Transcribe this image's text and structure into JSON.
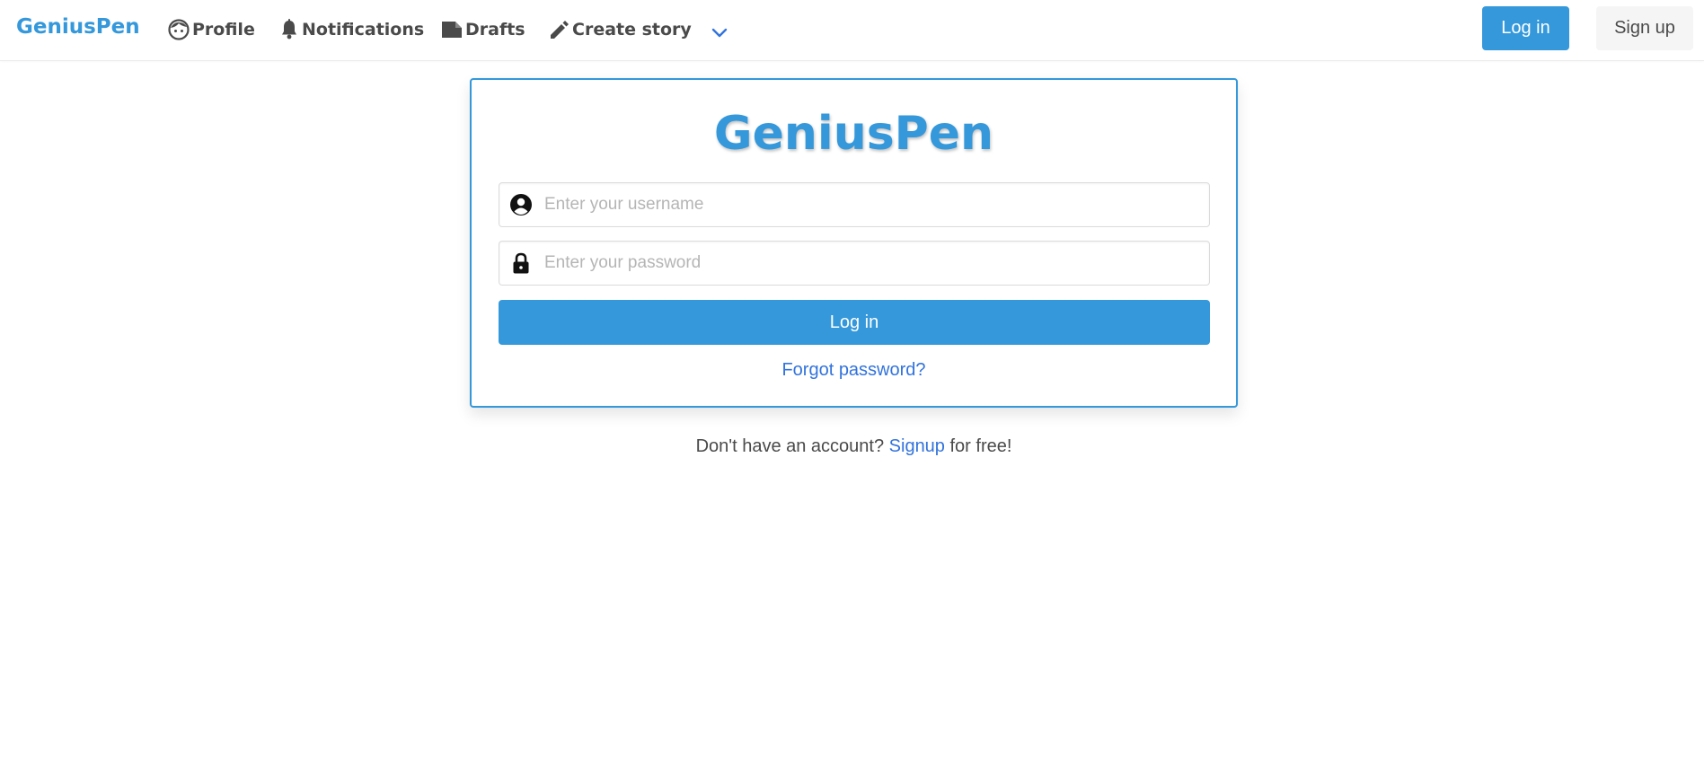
{
  "nav": {
    "brand": "GeniusPen",
    "profile": "Profile",
    "notifications": "Notifications",
    "drafts": "Drafts",
    "create_story": "Create story",
    "login": "Log in",
    "signup": "Sign up"
  },
  "login_card": {
    "logo": "GeniusPen",
    "username_placeholder": "Enter your username",
    "password_placeholder": "Enter your password",
    "login_button": "Log in",
    "forgot_password": "Forgot password?"
  },
  "signup_prompt": {
    "prefix": "Don't have an account? ",
    "link": "Signup",
    "suffix": " for free!"
  },
  "icons": {
    "profile": "face-icon",
    "notifications": "bell-icon",
    "drafts": "folder-icon",
    "create_story": "pencil-icon",
    "more": "chevron-down-icon",
    "username": "user-circle-icon",
    "password": "lock-icon"
  },
  "colors": {
    "primary": "#3498db",
    "link": "#3273dc",
    "nav_text": "#4a4a4a",
    "secondary_button": "#f5f5f5"
  }
}
